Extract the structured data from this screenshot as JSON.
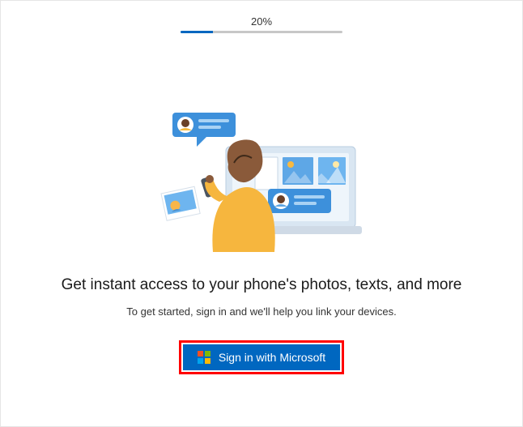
{
  "progress": {
    "percent_label": "20%",
    "percent_value": 20
  },
  "main": {
    "heading": "Get instant access to your phone's photos, texts, and more",
    "subheading": "To get started, sign in and we'll help you link your devices."
  },
  "signin": {
    "button_label": "Sign in with Microsoft"
  },
  "colors": {
    "accent": "#0067c0",
    "highlight_border": "#ff0000"
  }
}
